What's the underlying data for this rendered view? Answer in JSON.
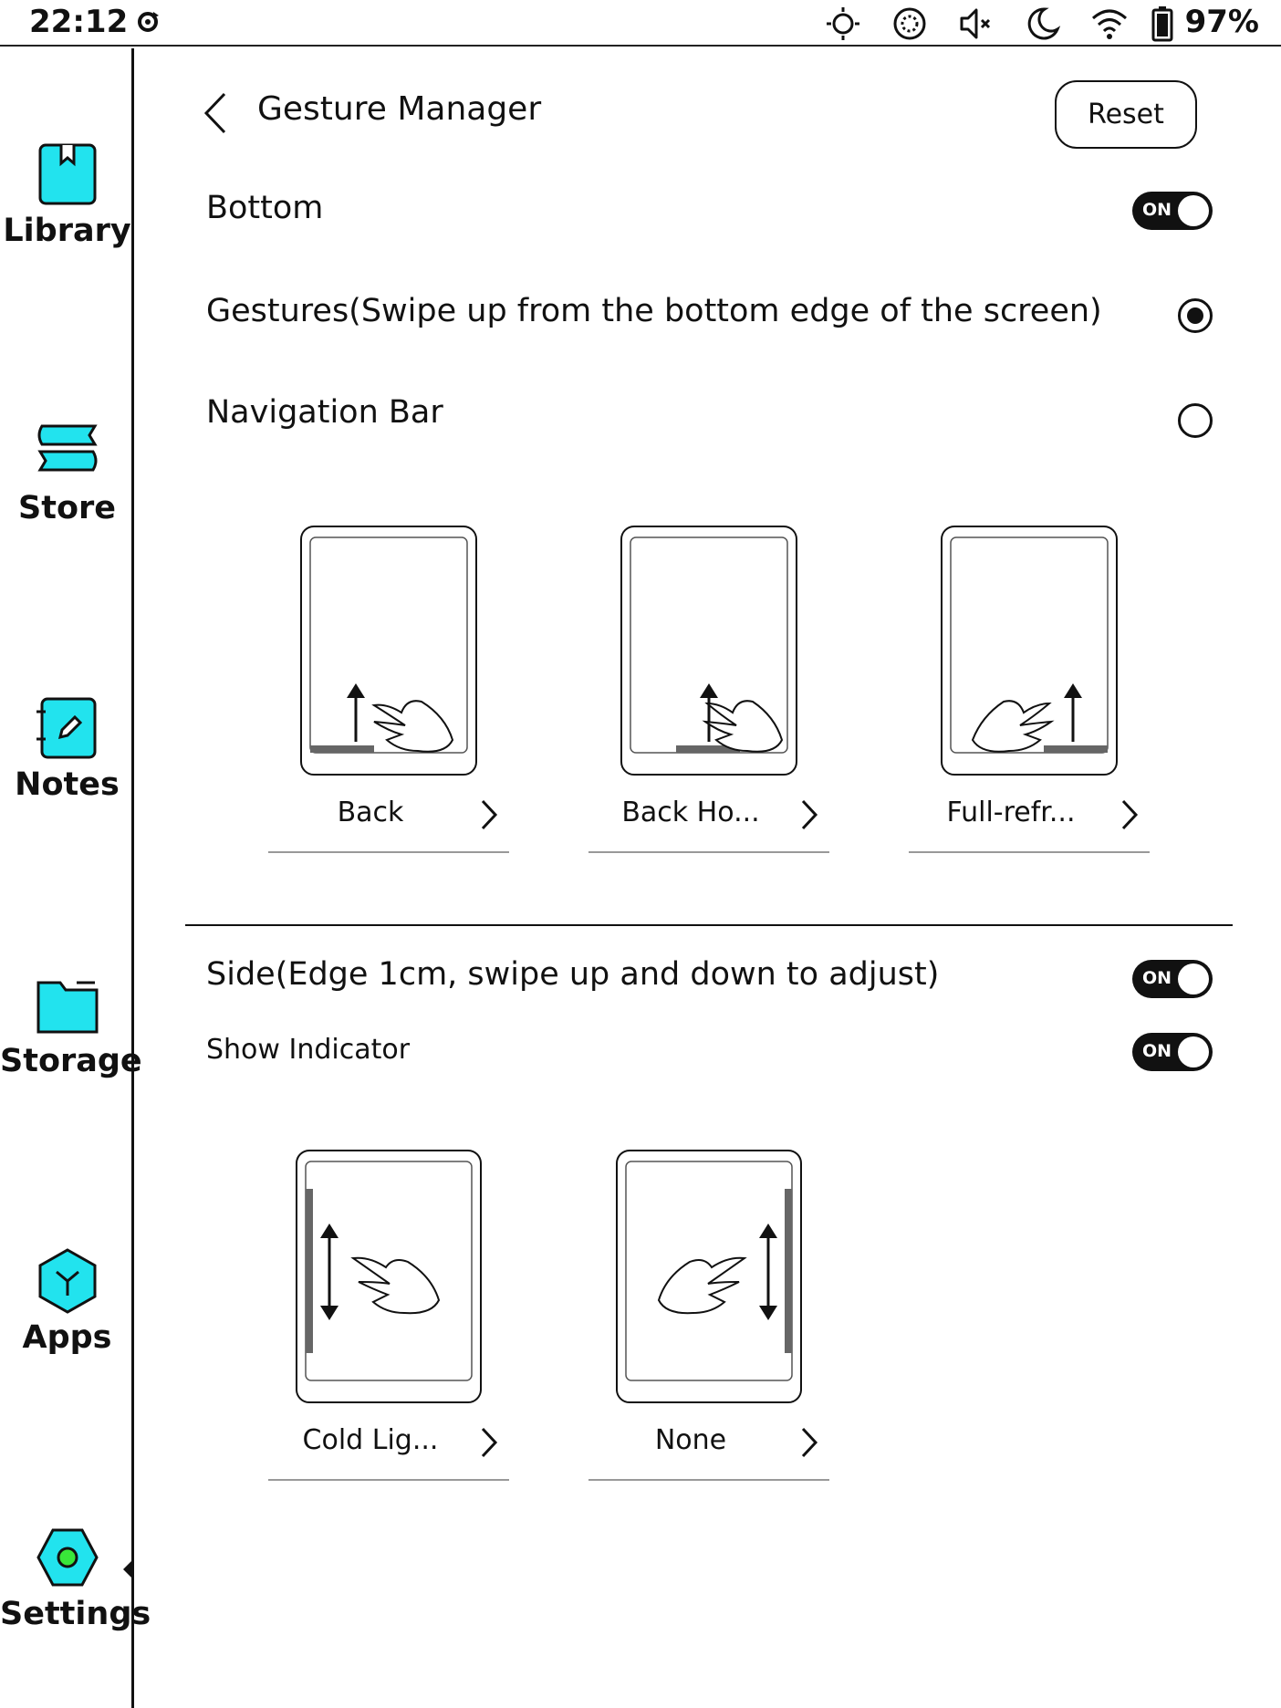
{
  "status_bar": {
    "time": "22:12",
    "battery": "97%",
    "icons": [
      "sync-icon",
      "brightness-icon",
      "refresh-mode-icon",
      "mute-icon",
      "night-mode-icon",
      "wifi-icon",
      "battery-icon"
    ]
  },
  "sidebar": {
    "accent_color": "#22e3ee",
    "items": [
      {
        "label": "Library",
        "icon": "library-icon"
      },
      {
        "label": "Store",
        "icon": "store-icon"
      },
      {
        "label": "Notes",
        "icon": "notes-icon"
      },
      {
        "label": "Storage",
        "icon": "storage-icon"
      },
      {
        "label": "Apps",
        "icon": "apps-icon"
      },
      {
        "label": "Settings",
        "icon": "settings-icon",
        "selected": true
      }
    ]
  },
  "header": {
    "title": "Gesture Manager",
    "reset_label": "Reset"
  },
  "bottom_section": {
    "label": "Bottom",
    "toggle_text": "ON",
    "toggle_on": true,
    "options": [
      {
        "label": "Gestures(Swipe up from the bottom edge of the screen)",
        "selected": true
      },
      {
        "label": "Navigation Bar",
        "selected": false
      }
    ],
    "gestures": [
      {
        "label": "Back"
      },
      {
        "label": "Back Ho..."
      },
      {
        "label": "Full-refr..."
      }
    ]
  },
  "side_section": {
    "label": "Side(Edge 1cm, swipe up and down to adjust)",
    "toggle_text": "ON",
    "toggle_on": true,
    "indicator_label": "Show Indicator",
    "indicator_toggle_text": "ON",
    "indicator_on": true,
    "gestures": [
      {
        "label": "Cold Lig..."
      },
      {
        "label": "None"
      }
    ]
  }
}
